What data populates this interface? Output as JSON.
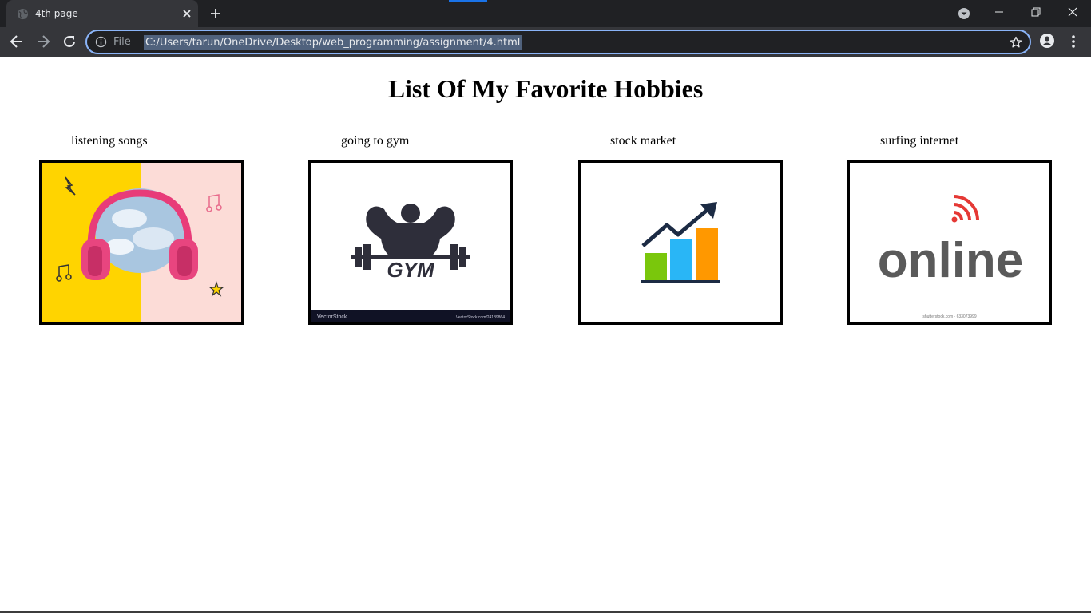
{
  "browser": {
    "tab_title": "4th page",
    "url_scheme_label": "File",
    "url": "C:/Users/tarun/OneDrive/Desktop/web_programming/assignment/4.html",
    "accent_color": "#8ab4f8"
  },
  "page": {
    "heading": "List Of My Favorite Hobbies",
    "hobbies": [
      {
        "label": "listening songs",
        "image": "headphones-image"
      },
      {
        "label": "going to gym",
        "image": "gym-logo-image",
        "footer_left": "VectorStock",
        "footer_right": "VectorStock.com/24189864",
        "logo_text": "GYM"
      },
      {
        "label": "stock market",
        "image": "stock-chart-image"
      },
      {
        "label": "surfing internet",
        "image": "online-logo-image",
        "logo_text": "online",
        "footer": "shutterstock.com · 633073999"
      }
    ]
  }
}
